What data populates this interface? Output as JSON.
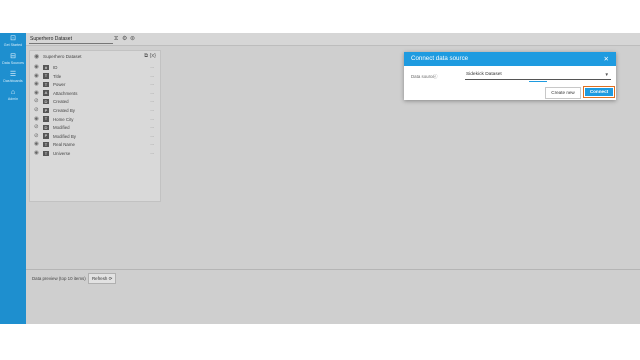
{
  "sidebar": {
    "items": [
      {
        "label": "Get Started",
        "icon": "rocket-icon"
      },
      {
        "label": "Data Sources",
        "icon": "database-icon"
      },
      {
        "label": "Dashboards",
        "icon": "list-icon"
      },
      {
        "label": "Admin",
        "icon": "bank-icon"
      }
    ]
  },
  "toolbar": {
    "dataset_name": "Superhero Dataset"
  },
  "fields_panel": {
    "title": "Superhero Dataset",
    "fields": [
      {
        "name": "ID",
        "type_icon": "#",
        "visible": true
      },
      {
        "name": "Title",
        "type_icon": "T",
        "visible": true
      },
      {
        "name": "Power",
        "type_icon": "T",
        "visible": true
      },
      {
        "name": "Attachments",
        "type_icon": "A",
        "visible": true
      },
      {
        "name": "Created",
        "type_icon": "D",
        "visible": false
      },
      {
        "name": "Created By",
        "type_icon": "P",
        "visible": false
      },
      {
        "name": "Home City",
        "type_icon": "T",
        "visible": true
      },
      {
        "name": "Modified",
        "type_icon": "D",
        "visible": false
      },
      {
        "name": "Modified By",
        "type_icon": "P",
        "visible": false
      },
      {
        "name": "Real Name",
        "type_icon": "T",
        "visible": true
      },
      {
        "name": "Universe",
        "type_icon": "T",
        "visible": true
      }
    ],
    "more_label": "..."
  },
  "preview": {
    "label": "Data preview (top 10 items)",
    "refresh_label": "Refresh ⟳"
  },
  "dialog": {
    "title": "Connect data source",
    "close": "✕",
    "data_source_label": "Data source",
    "data_source_value": "Sidekick Dataset",
    "create_new_label": "Create new",
    "connect_label": "Connect",
    "accent_color": "#1e9be0",
    "highlight_color": "#e07020"
  }
}
